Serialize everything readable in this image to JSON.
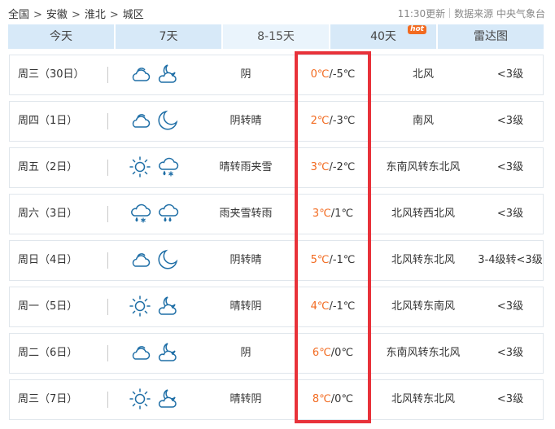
{
  "breadcrumb": {
    "items": [
      "全国",
      "安徽",
      "淮北",
      "城区"
    ],
    "separator": ">"
  },
  "update": {
    "time": "11:30更新",
    "source": "数据来源 中央气象台"
  },
  "tabs": [
    {
      "label": "今天",
      "active": false
    },
    {
      "label": "7天",
      "active": false
    },
    {
      "label": "8-15天",
      "active": true
    },
    {
      "label": "40天",
      "active": false,
      "badge": "hot"
    },
    {
      "label": "雷达图",
      "active": false
    }
  ],
  "colors": {
    "tab_bg": "#d7e9f8",
    "tab_active_bg": "#eaf4fc",
    "high_temp": "#f26b21",
    "hot_badge": "#f26b21",
    "highlight_box": "#e8323a",
    "icon_stroke": "#1e6ea6"
  },
  "forecast": [
    {
      "day": "周三（30日）",
      "icons": [
        "cloudy-icon",
        "partly-cloudy-night-icon"
      ],
      "desc": "阴",
      "high": "0℃",
      "low": "/-5℃",
      "wind": "北风",
      "level": "<3级"
    },
    {
      "day": "周四（1日）",
      "icons": [
        "cloudy-icon",
        "moon-icon"
      ],
      "desc": "阴转晴",
      "high": "2℃",
      "low": "/-3℃",
      "wind": "南风",
      "level": "<3级"
    },
    {
      "day": "周五（2日）",
      "icons": [
        "sun-icon",
        "sleet-icon"
      ],
      "desc": "晴转雨夹雪",
      "high": "3℃",
      "low": "/-2℃",
      "wind": "东南风转东北风",
      "level": "<3级"
    },
    {
      "day": "周六（3日）",
      "icons": [
        "sleet-icon",
        "rain-icon"
      ],
      "desc": "雨夹雪转雨",
      "high": "3℃",
      "low": "/1℃",
      "wind": "北风转西北风",
      "level": "<3级"
    },
    {
      "day": "周日（4日）",
      "icons": [
        "cloudy-icon",
        "moon-icon"
      ],
      "desc": "阴转晴",
      "high": "5℃",
      "low": "/-1℃",
      "wind": "北风转东北风",
      "level": "3-4级转<3级"
    },
    {
      "day": "周一（5日）",
      "icons": [
        "sun-icon",
        "partly-cloudy-night-icon"
      ],
      "desc": "晴转阴",
      "high": "4℃",
      "low": "/-1℃",
      "wind": "北风转东南风",
      "level": "<3级"
    },
    {
      "day": "周二（6日）",
      "icons": [
        "cloudy-icon",
        "partly-cloudy-night-icon"
      ],
      "desc": "阴",
      "high": "6℃",
      "low": "/0℃",
      "wind": "东南风转东北风",
      "level": "<3级"
    },
    {
      "day": "周三（7日）",
      "icons": [
        "sun-icon",
        "partly-cloudy-night-icon"
      ],
      "desc": "晴转阴",
      "high": "8℃",
      "low": "/0℃",
      "wind": "北风转东北风",
      "level": "<3级"
    }
  ]
}
